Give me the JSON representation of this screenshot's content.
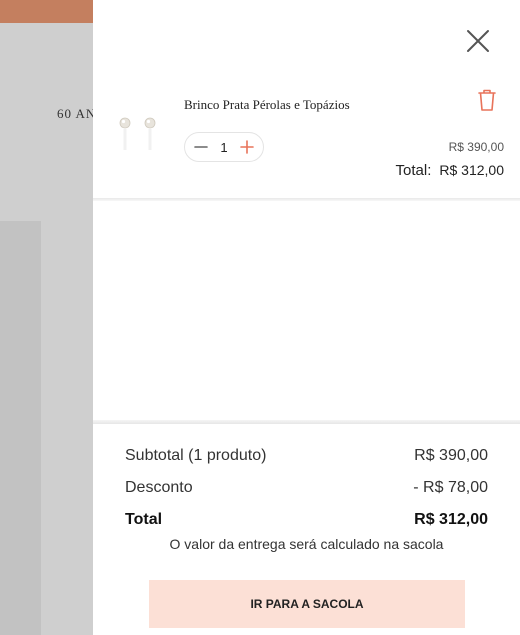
{
  "background": {
    "partial_text": "60 AN",
    "topbar_color": "#c47f5f"
  },
  "drawer": {
    "close_icon": "close-icon",
    "item": {
      "name": "Brinco Prata Pérolas e Topázios",
      "image_icon": "pearl-earrings-image",
      "delete_icon": "trash-icon",
      "quantity": "1",
      "minus_icon": "minus-icon",
      "plus_icon": "plus-icon",
      "old_price": "R$ 390,00",
      "total_label": "Total:",
      "total_value": "R$ 312,00"
    },
    "summary": {
      "subtotal_label": "Subtotal (1 produto)",
      "subtotal_value": "R$ 390,00",
      "discount_label": "Desconto",
      "discount_value": "- R$ 78,00",
      "total_label": "Total",
      "total_value": "R$ 312,00"
    },
    "shipping_note": "O valor da entrega será calculado na sacola",
    "go_to_bag_label": "IR PARA A SACOLA",
    "accent_color": "#e8735a",
    "button_color": "#fce0d6"
  }
}
